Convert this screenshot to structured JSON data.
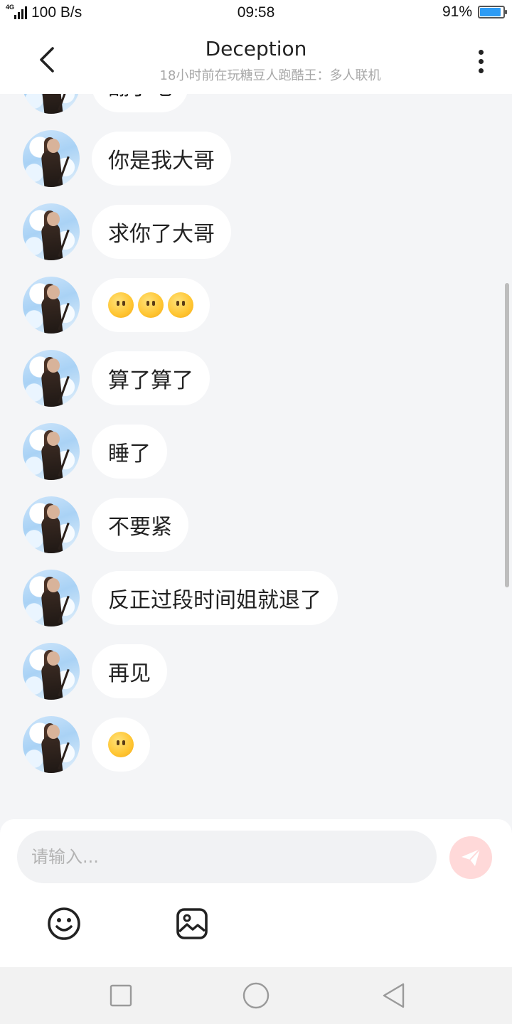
{
  "status_bar": {
    "network": "4G",
    "speed": "100 B/s",
    "time": "09:58",
    "battery_text": "91%",
    "battery_level": 0.91
  },
  "header": {
    "title": "Deception",
    "subtitle": "18小时前在玩糖豆人跑酷王：多人联机",
    "back_icon": "chevron-left-icon",
    "more_icon": "more-vertical-icon"
  },
  "messages": [
    {
      "text": "翻了吧",
      "emoji_count": 0
    },
    {
      "text": "你是我大哥",
      "emoji_count": 0
    },
    {
      "text": "求你了大哥",
      "emoji_count": 0
    },
    {
      "text": "",
      "emoji_count": 3
    },
    {
      "text": "算了算了",
      "emoji_count": 0
    },
    {
      "text": "睡了",
      "emoji_count": 0
    },
    {
      "text": "不要紧",
      "emoji_count": 0
    },
    {
      "text": "反正过段时间姐就退了",
      "emoji_count": 0
    },
    {
      "text": "再见",
      "emoji_count": 0
    },
    {
      "text": "",
      "emoji_count": 1
    }
  ],
  "composer": {
    "placeholder": "请输入...",
    "send_icon": "send-icon",
    "emoji_icon": "smiley-icon",
    "image_icon": "image-icon"
  },
  "nav": {
    "recent_icon": "square-icon",
    "home_icon": "circle-icon",
    "back_icon": "triangle-back-icon"
  },
  "colors": {
    "background": "#f4f5f7",
    "bubble": "#ffffff",
    "send_button": "#ffd9d9",
    "battery_fill": "#2d9cf5"
  }
}
